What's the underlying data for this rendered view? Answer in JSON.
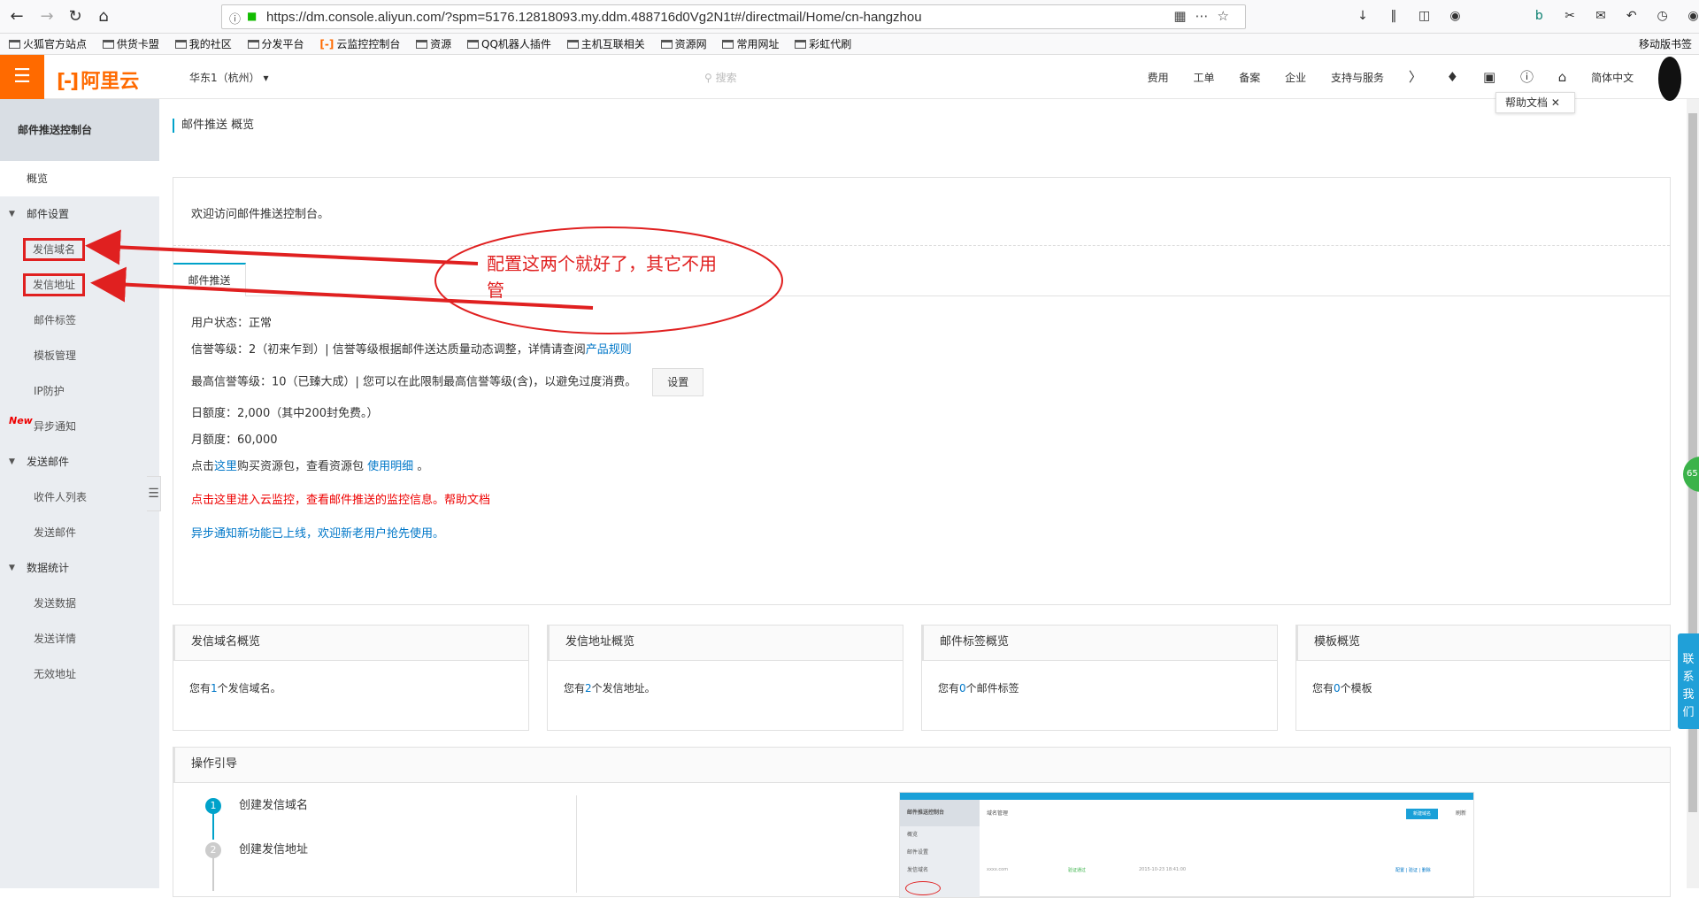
{
  "browser": {
    "url": "https://dm.console.aliyun.com/?spm=5176.12818093.my.ddm.488716d0Vg2N1t#/directmail/Home/cn-hangzhou",
    "bookmarks": [
      "火狐官方站点",
      "供货卡盟",
      "我的社区",
      "分发平台",
      "云监控控制台",
      "资源",
      "QQ机器人插件",
      "主机互联相关",
      "资源网",
      "常用网址",
      "彩虹代刷"
    ],
    "mobile_bookmarks": "移动版书签"
  },
  "topbar": {
    "logo": "阿里云",
    "region": "华东1（杭州）",
    "search_placeholder": "搜索",
    "nav": [
      "费用",
      "工单",
      "备案",
      "企业",
      "支持与服务"
    ],
    "language": "简体中文",
    "help_tip": "帮助文档"
  },
  "sidebar": {
    "title": "邮件推送控制台",
    "overview": "概览",
    "groups": [
      {
        "label": "邮件设置",
        "items": [
          "发信域名",
          "发信地址",
          "邮件标签",
          "模板管理",
          "IP防护",
          "异步通知"
        ]
      },
      {
        "label": "发送邮件",
        "items": [
          "收件人列表",
          "发送邮件"
        ]
      },
      {
        "label": "数据统计",
        "items": [
          "发送数据",
          "发送详情",
          "无效地址"
        ]
      }
    ],
    "new_tag": "New"
  },
  "main": {
    "breadcrumb": "邮件推送 概览",
    "welcome": "欢迎访问邮件推送控制台。",
    "tab": "邮件推送",
    "user_status": "用户状态：正常",
    "credit_level_prefix": "信誉等级：2（初来乍到）| 信誉等级根据邮件送达质量动态调整，详情请查阅",
    "credit_level_link": "产品规则",
    "max_credit": "最高信誉等级：10（已臻大成）| 您可以在此限制最高信誉等级(含)，以避免过度消费。",
    "set_button": "设置",
    "daily_quota": "日额度：2,000（其中200封免费。）",
    "monthly_quota": "月额度：60,000",
    "buy_prefix": "点击",
    "buy_link": "这里",
    "buy_middle": "购买资源包，查看资源包 ",
    "buy_link2": "使用明细",
    "buy_suffix": " 。",
    "monitor_link": "点击这里进入云监控，查看邮件推送的监控信息。帮助文档",
    "async_notice": "异步通知新功能已上线，欢迎新老用户抢先使用。"
  },
  "cards": [
    {
      "title": "发信域名概览",
      "prefix": "您有",
      "count": "1",
      "suffix": "个发信域名。"
    },
    {
      "title": "发信地址概览",
      "prefix": "您有",
      "count": "2",
      "suffix": "个发信地址。"
    },
    {
      "title": "邮件标签概览",
      "prefix": "您有",
      "count": "0",
      "suffix": "个邮件标签"
    },
    {
      "title": "模板概览",
      "prefix": "您有",
      "count": "0",
      "suffix": "个模板"
    }
  ],
  "guide": {
    "title": "操作引导",
    "steps": [
      {
        "num": "1",
        "label": "创建发信域名"
      },
      {
        "num": "2",
        "label": "创建发信地址"
      }
    ],
    "preview": {
      "sidebar_title": "邮件推送控制台",
      "items": [
        "概览",
        "邮件设置",
        "发信域名"
      ],
      "page_title": "域名管理",
      "new_button": "新建域名",
      "refresh": "刷新",
      "row_domain": "xxxx.com",
      "row_status": "验证通过",
      "row_time": "2015-10-23 18:41:00",
      "row_actions": "配置 | 验证 | 删除"
    }
  },
  "annotation": "配置这两个就好了，其它不用管",
  "widgets": {
    "badge": "65",
    "contact": "联系我们"
  },
  "colors": {
    "brand": "#ff6a00",
    "accent": "#00a2ca",
    "link": "#0077c8",
    "annotation_red": "#e02020"
  }
}
